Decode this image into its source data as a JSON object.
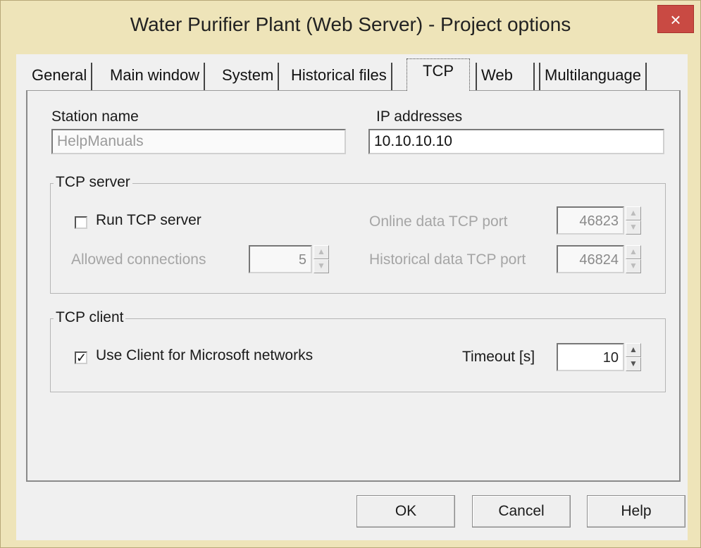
{
  "window": {
    "title": "Water Purifier Plant (Web Server) - Project options",
    "close": "×"
  },
  "tabs": [
    {
      "label": "General"
    },
    {
      "label": "Main window"
    },
    {
      "label": "System"
    },
    {
      "label": "Historical files"
    },
    {
      "label": "TCP",
      "active": true
    },
    {
      "label": "Web"
    },
    {
      "label": "Multilanguage"
    }
  ],
  "station": {
    "label": "Station name",
    "value": "HelpManuals"
  },
  "ip": {
    "label": "IP addresses",
    "value": "10.10.10.10"
  },
  "tcp_server": {
    "title": "TCP server",
    "run_label": "Run TCP server",
    "run_checked": false,
    "allowed_label": "Allowed connections",
    "allowed_value": "5",
    "online_port_label": "Online data TCP port",
    "online_port_value": "46823",
    "historical_port_label": "Historical data TCP port",
    "historical_port_value": "46824"
  },
  "tcp_client": {
    "title": "TCP client",
    "use_client_label": "Use Client for Microsoft networks",
    "use_client_mark": "✓",
    "timeout_label": "Timeout [s]",
    "timeout_value": "10"
  },
  "spin": {
    "up": "▲",
    "down": "▼"
  },
  "buttons": {
    "ok": "OK",
    "cancel": "Cancel",
    "help": "Help"
  },
  "colors": {
    "frame": "#eee4b9",
    "close": "#c94a43",
    "disabled_text": "#a5a5a5"
  }
}
